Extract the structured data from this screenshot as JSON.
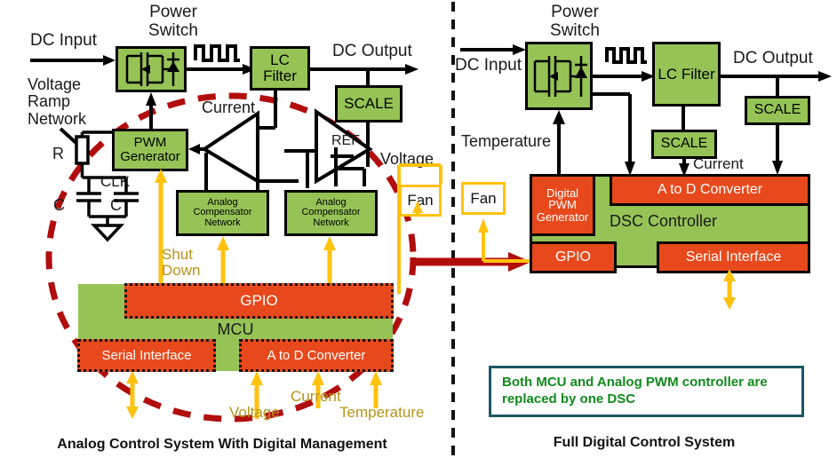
{
  "figure": {
    "left_caption": "Analog Control System With Digital Management",
    "right_caption": "Full Digital Control System",
    "note": "Both MCU and Analog PWM controller are replaced by one DSC",
    "colors": {
      "green_block": "#96c356",
      "orange_block": "#e8491c",
      "gold_signal": "#ffc20e",
      "gold_label_text": "#b59318",
      "red_highlight": "#b10d0d",
      "note_border": "#1d5662",
      "note_text": "#0f8a1b",
      "wire": "#000000"
    }
  },
  "left_panel": {
    "title": "Analog Control System With Digital Management",
    "labels": {
      "power_switch": "Power\nSwitch",
      "dc_input": "DC Input",
      "dc_output": "DC Output",
      "voltage_ramp_network": "Voltage\nRamp\nNetwork",
      "resistor": "R",
      "cap_left": "C",
      "cap_right": "C",
      "clk": "CLK",
      "current": "Current",
      "ref": "REF",
      "voltage_out": "Voltage",
      "shut_down": "Shut\nDown",
      "adc_voltage": "Voltage",
      "adc_current": "Current",
      "adc_temperature": "Temperature"
    },
    "blocks": {
      "power_switch": "",
      "lc_filter": "LC\nFilter",
      "scale": "SCALE",
      "pwm_generator": "PWM\nGenerator",
      "analog_comp_1": "Analog\nCompensator\nNetwork",
      "analog_comp_2": "Analog\nCompensator\nNetwork",
      "fan": "Fan",
      "mcu": "MCU",
      "gpio": "GPIO",
      "serial_interface": "Serial Interface",
      "a_to_d_converter": "A to D Converter"
    }
  },
  "right_panel": {
    "title": "Full Digital Control System",
    "labels": {
      "power_switch": "Power\nSwitch",
      "dc_input": "DC Input",
      "dc_output": "DC Output",
      "temperature": "Temperature",
      "current": "Current"
    },
    "blocks": {
      "lc_filter": "LC\nFilter",
      "scale_current": "SCALE",
      "scale_voltage": "SCALE",
      "fan": "Fan",
      "digital_pwm_generator": "Digital\nPWM\nGenerator",
      "a_to_d_converter": "A to D Converter",
      "dsc_controller": "DSC Controller",
      "gpio": "GPIO",
      "serial_interface": "Serial Interface"
    }
  }
}
